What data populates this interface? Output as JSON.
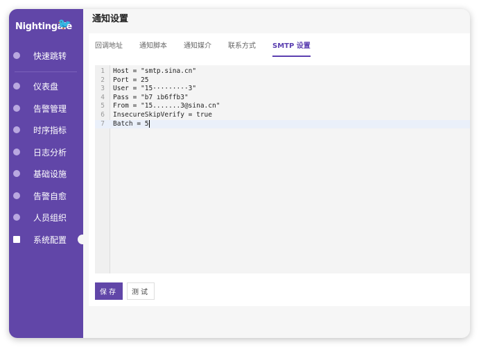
{
  "sidebar": {
    "logo": "Nightingale",
    "items": [
      {
        "label": "快速跳转",
        "icon": "search-icon"
      },
      {
        "label": "仪表盘",
        "icon": "dashboard-icon"
      },
      {
        "label": "告警管理",
        "icon": "alarm-icon"
      },
      {
        "label": "时序指标",
        "icon": "chart-icon"
      },
      {
        "label": "日志分析",
        "icon": "log-icon"
      },
      {
        "label": "基础设施",
        "icon": "server-icon"
      },
      {
        "label": "告警自愈",
        "icon": "terminal-icon"
      },
      {
        "label": "人员组织",
        "icon": "user-icon"
      },
      {
        "label": "系统配置",
        "icon": "grid-icon"
      }
    ]
  },
  "page": {
    "title": "通知设置"
  },
  "tabs": [
    "回调地址",
    "通知脚本",
    "通知媒介",
    "联系方式",
    "SMTP 设置"
  ],
  "editor": {
    "lines": [
      "Host = \"smtp.sina.cn\"",
      "Port = 25",
      "User = \"15·········3\"",
      "Pass = \"b7        ıb6ffb3\"",
      "From = \"15.......3@sina.cn\"",
      "InsecureSkipVerify = true",
      "Batch = 5"
    ]
  },
  "buttons": {
    "save": "保存",
    "test": "测试"
  },
  "colors": {
    "accent": "#6146a8"
  }
}
